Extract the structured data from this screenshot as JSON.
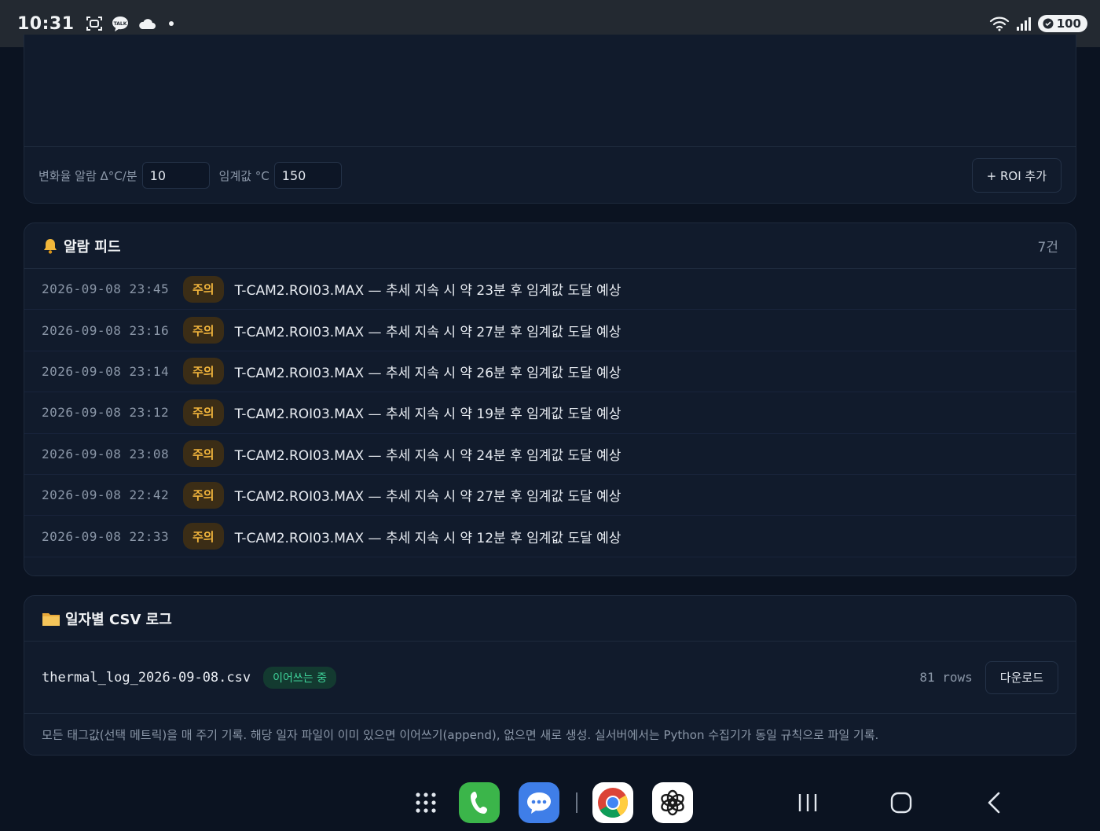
{
  "status_bar": {
    "time": "10:31",
    "battery": "100"
  },
  "controls": {
    "rate_label": "변화율 알람 Δ°C/분",
    "rate_value": "10",
    "threshold_label": "임계값 °C",
    "threshold_value": "150",
    "add_roi_label": "+ ROI 추가"
  },
  "alarm_feed": {
    "title": "알람 피드",
    "count": "7건",
    "items": [
      {
        "time": "2026-09-08 23:45",
        "level": "주의",
        "message": "T-CAM2.ROI03.MAX — 추세 지속 시 약 23분 후 임계값 도달 예상"
      },
      {
        "time": "2026-09-08 23:16",
        "level": "주의",
        "message": "T-CAM2.ROI03.MAX — 추세 지속 시 약 27분 후 임계값 도달 예상"
      },
      {
        "time": "2026-09-08 23:14",
        "level": "주의",
        "message": "T-CAM2.ROI03.MAX — 추세 지속 시 약 26분 후 임계값 도달 예상"
      },
      {
        "time": "2026-09-08 23:12",
        "level": "주의",
        "message": "T-CAM2.ROI03.MAX — 추세 지속 시 약 19분 후 임계값 도달 예상"
      },
      {
        "time": "2026-09-08 23:08",
        "level": "주의",
        "message": "T-CAM2.ROI03.MAX — 추세 지속 시 약 24분 후 임계값 도달 예상"
      },
      {
        "time": "2026-09-08 22:42",
        "level": "주의",
        "message": "T-CAM2.ROI03.MAX — 추세 지속 시 약 27분 후 임계값 도달 예상"
      },
      {
        "time": "2026-09-08 22:33",
        "level": "주의",
        "message": "T-CAM2.ROI03.MAX — 추세 지속 시 약 12분 후 임계값 도달 예상"
      }
    ]
  },
  "csv_log": {
    "title": "일자별 CSV 로그",
    "file_name": "thermal_log_2026-09-08.csv",
    "status_badge": "이어쓰는 중",
    "rows": "81 rows",
    "download_label": "다운로드",
    "note": "모든 태그값(선택 메트릭)을 매 주기 기록. 해당 일자 파일이 이미 있으면 이어쓰기(append), 없으면 새로 생성. 실서버에서는 Python 수집기가 동일 규칙으로 파일 기록."
  },
  "icons": {
    "bell": "bell-icon",
    "folder": "folder-icon",
    "apps": "app-drawer-icon",
    "phone": "phone-app-icon",
    "messages": "messages-app-icon",
    "chrome": "chrome-app-icon",
    "chatgpt": "chatgpt-app-icon"
  },
  "colors": {
    "background": "#0b1321",
    "card": "#111b2c",
    "warn_badge_bg": "#3b2d16",
    "warn_badge_text": "#f0b43c",
    "live_badge_bg": "#133a30",
    "live_badge_text": "#3fd39a"
  }
}
